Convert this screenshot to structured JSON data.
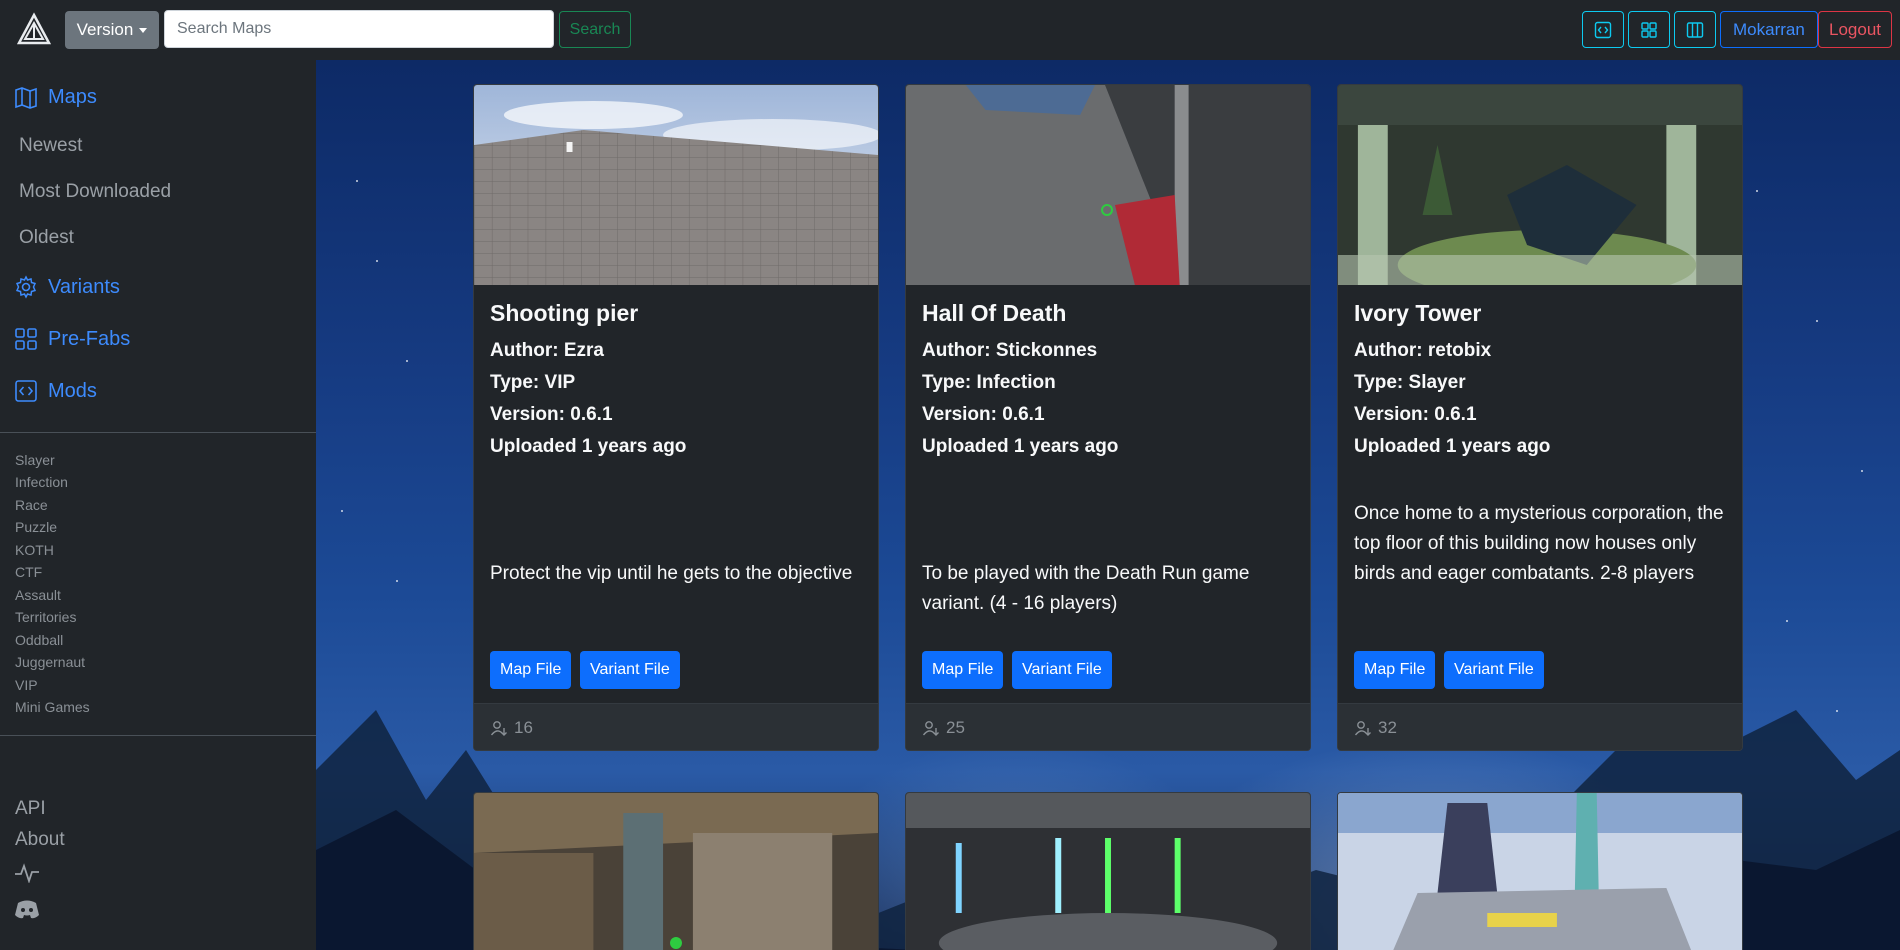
{
  "navbar": {
    "version_label": "Version",
    "search_placeholder": "Search Maps",
    "search_label": "Search",
    "user_label": "Mokarran",
    "logout_label": "Logout"
  },
  "sidebar": {
    "main_items": [
      {
        "label": "Maps",
        "icon": "map-icon"
      },
      {
        "label": "Variants",
        "icon": "gear-icon"
      },
      {
        "label": "Pre-Fabs",
        "icon": "grid-icon"
      },
      {
        "label": "Mods",
        "icon": "code-icon"
      }
    ],
    "sort_items": [
      "Newest",
      "Most Downloaded",
      "Oldest"
    ],
    "categories": [
      "Slayer",
      "Infection",
      "Race",
      "Puzzle",
      "KOTH",
      "CTF",
      "Assault",
      "Territories",
      "Oddball",
      "Juggernaut",
      "VIP",
      "Mini Games"
    ],
    "footer": {
      "api": "API",
      "about": "About"
    }
  },
  "cards": [
    {
      "title": "Shooting pier",
      "author": "Author: Ezra",
      "type": "Type: VIP",
      "version": "Version: 0.6.1",
      "uploaded": "Uploaded 1 years ago",
      "description": "Protect the vip until he gets to the objective",
      "map_file": "Map File",
      "variant_file": "Variant File",
      "downloads": "16"
    },
    {
      "title": "Hall Of Death",
      "author": "Author: Stickonnes",
      "type": "Type: Infection",
      "version": "Version: 0.6.1",
      "uploaded": "Uploaded 1 years ago",
      "description": "To be played with the Death Run game variant. (4 - 16 players)",
      "map_file": "Map File",
      "variant_file": "Variant File",
      "downloads": "25"
    },
    {
      "title": "Ivory Tower",
      "author": "Author: retobix",
      "type": "Type: Slayer",
      "version": "Version: 0.6.1",
      "uploaded": "Uploaded 1 years ago",
      "description": "Once home to a mysterious corporation, the top floor of this building now houses only birds and eager combatants. 2-8 players",
      "map_file": "Map File",
      "variant_file": "Variant File",
      "downloads": "32"
    }
  ],
  "colors": {
    "primary": "#0d6efd",
    "success": "#198754",
    "info": "#0dcaf0",
    "danger": "#dc3545",
    "background": "#212529"
  }
}
